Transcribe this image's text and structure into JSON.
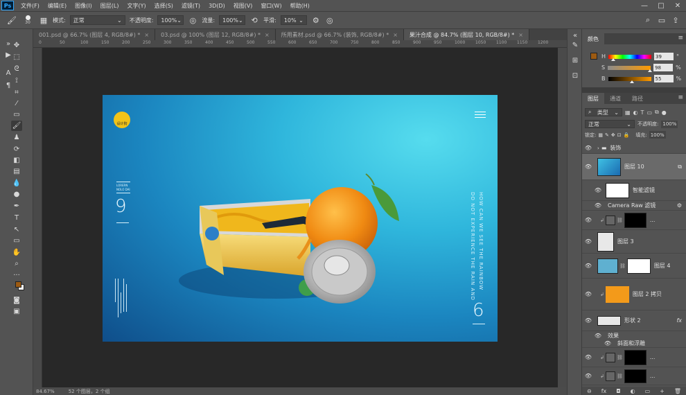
{
  "app": {
    "logo": "Ps"
  },
  "menu": [
    "文件(F)",
    "编辑(E)",
    "图像(I)",
    "图层(L)",
    "文字(Y)",
    "选择(S)",
    "滤镜(T)",
    "3D(D)",
    "视图(V)",
    "窗口(W)",
    "帮助(H)"
  ],
  "window_controls": [
    "—",
    "□",
    "✕"
  ],
  "options": {
    "brush_size": "30",
    "mode_label": "模式:",
    "mode_value": "正常",
    "opacity_label": "不透明度:",
    "opacity_value": "100%",
    "flow_label": "流量:",
    "flow_value": "100%",
    "smooth_label": "平滑:",
    "smooth_value": "10%"
  },
  "tabs": [
    {
      "label": "001.psd @ 66.7% (图层 4, RGB/8#) *",
      "close": "×"
    },
    {
      "label": "03.psd @ 100% (图层 12, RGB/8#) *",
      "close": "×"
    },
    {
      "label": "所用素材.psd @ 66.7% (装饰, RGB/8#) *",
      "close": "×"
    },
    {
      "label": "果汁合成 @ 84.7% (图层 10, RGB/8#) *",
      "close": "×"
    }
  ],
  "ruler_ticks": [
    "0",
    "50",
    "100",
    "150",
    "200",
    "250",
    "300",
    "350",
    "400",
    "450",
    "500",
    "550",
    "600",
    "650",
    "700",
    "750",
    "800",
    "850",
    "900",
    "950",
    "1000",
    "1050",
    "1100",
    "1150",
    "1200"
  ],
  "status": {
    "zoom": "84.67%",
    "info": "52 个图层，2 个组"
  },
  "artboard": {
    "logo_text": "设计狗",
    "lbl_lines": [
      "LORERN",
      "NOLO DAI"
    ],
    "num_left": "9",
    "num_right": "6",
    "vertical_text_1": "DO NOT EXPERIENCE THE RAIN AND",
    "vertical_text_2": "HOW CAN WE SEE THE RAINBOW"
  },
  "color_panel": {
    "tab": "颜色",
    "fg": "#9c5a12",
    "bg": "#ffffff",
    "rows": [
      {
        "ch": "H",
        "val": "39",
        "unit": "°",
        "pos": 0.11,
        "grad": "linear-gradient(90deg,#ff0000,#ffff00,#00ff00,#00ffff,#0000ff,#ff00ff,#ff0000)"
      },
      {
        "ch": "S",
        "val": "98",
        "unit": "%",
        "pos": 0.98,
        "grad": "linear-gradient(90deg,#8c8c8c,#ff9a00)"
      },
      {
        "ch": "B",
        "val": "55",
        "unit": "%",
        "pos": 0.55,
        "grad": "linear-gradient(90deg,#000000,#ff9a00)"
      }
    ]
  },
  "layers_panel": {
    "tabs": [
      "图层",
      "通道",
      "路径"
    ],
    "filter_value": "类型",
    "blend_value": "正常",
    "opacity_label": "不透明度:",
    "opacity_value": "100%",
    "lock_label": "锁定:",
    "fill_label": "填充:",
    "fill_value": "100%",
    "rows": {
      "group": "装饰",
      "layer10": "图层 10",
      "smart_filter": "智能滤镜",
      "camera_raw": "Camera Raw 滤镜",
      "layer3": "图层 3",
      "layer4": "图层 4",
      "layer2copy": "图层 2 拷贝",
      "shape2": "形状 2",
      "fx": "fx",
      "effects": "效果",
      "bevel": "斜面和浮雕",
      "dots": "..."
    },
    "bottom_icons": [
      "⊖",
      "fx",
      "◘",
      "◐",
      "▭",
      "+",
      "🗑"
    ]
  }
}
